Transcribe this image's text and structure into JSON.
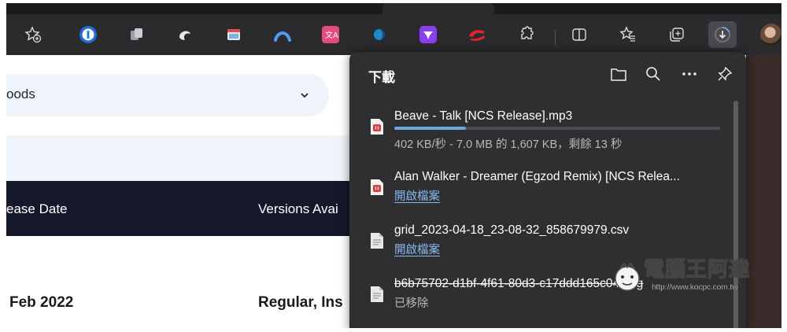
{
  "browser": {
    "toolbar_icons": [
      "add-favorite-icon",
      "onepassword-icon",
      "extension-copy-icon",
      "extension-swirl-icon",
      "extension-window-icon",
      "extension-arc-icon",
      "translate-icon",
      "extension-blue-orb-icon",
      "extension-purple-icon",
      "extension-red-icon",
      "extensions-icon",
      "split-screen-icon",
      "favorites-icon",
      "collections-icon",
      "downloads-icon",
      "profile-avatar"
    ]
  },
  "page": {
    "dropdown_text": "oods",
    "table_headers": [
      "ease Date",
      "Versions Avai"
    ],
    "row": {
      "date": "Feb 2022",
      "versions": "Regular, Ins"
    }
  },
  "downloads": {
    "title": "下載",
    "items": [
      {
        "file_name": "Beave - Talk [NCS Release].mp3",
        "status": "402 KB/秒 - 7.0 MB 的 1,607 KB，剩餘 13 秒",
        "progress": 0.22,
        "type": "audio"
      },
      {
        "file_name": "Alan Walker - Dreamer (Egzod Remix) [NCS Relea...",
        "action": "開啟檔案",
        "type": "audio"
      },
      {
        "file_name": "grid_2023-04-18_23-08-32_858679979.csv",
        "action": "開啟檔案",
        "type": "document"
      },
      {
        "file_name": "b6b75702-d1bf-4f61-80d3-c17ddd165c04.png",
        "status": "已移除",
        "type": "document"
      }
    ]
  },
  "watermark": {
    "brand": "電腦王阿達",
    "url": "http://www.kocpc.com.tw"
  },
  "colors": {
    "accent_link": "#8ab9f0",
    "progress": "#6aa7e6",
    "panel_bg": "#2f2f31",
    "table_header": "#14182a"
  }
}
